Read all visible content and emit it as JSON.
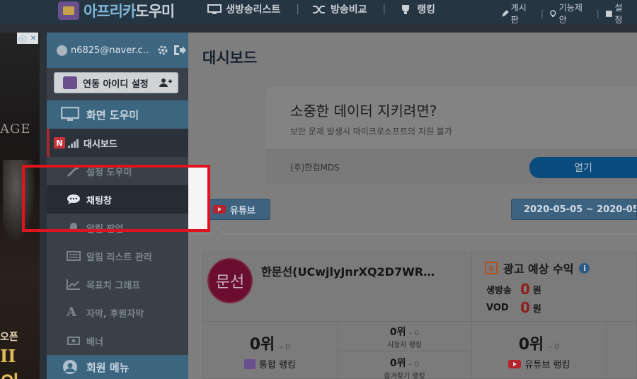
{
  "header": {
    "logo_text_a": "아프리카",
    "logo_text_b": "도우미",
    "nav": [
      {
        "label": "생방송리스트",
        "icon": "monitor-icon"
      },
      {
        "label": "방송비교",
        "icon": "shuffle-icon"
      },
      {
        "label": "랭킹",
        "icon": "trophy-icon"
      }
    ],
    "right_links": [
      {
        "label": "게시판",
        "icon": "pencil-icon"
      },
      {
        "label": "기능제안",
        "icon": "lightbulb-icon"
      },
      {
        "label": "설정",
        "icon": "book-icon"
      }
    ]
  },
  "left_ad": {
    "word": "AGE",
    "line1": "오픈",
    "line2": "II",
    "line3": "의"
  },
  "sidebar": {
    "user_email": "n6825@naver.c…",
    "link_account_label": "연동 아이디 설정",
    "group_screen": "화면 도우미",
    "group_member": "회원 메뉴",
    "items": [
      {
        "label": "대시보드",
        "badge": "N"
      },
      {
        "label": "설정 도우미"
      },
      {
        "label": "채팅창"
      },
      {
        "label": "알림 팝업"
      },
      {
        "label": "알림 리스트 관리"
      },
      {
        "label": "목표치 그래프"
      },
      {
        "label": "자막, 후원자막"
      },
      {
        "label": "배너"
      }
    ]
  },
  "main": {
    "page_title": "대시보드",
    "ad": {
      "headline": "소중한 데이터 지키려면?",
      "sub": "보안 문제 발생시 마이크로소프트의 지원 불가",
      "company": "(주)한컴MDS",
      "open_label": "열기"
    },
    "platform_button": "유튜브",
    "date_range": "2020-05-05 ~ 2020-05",
    "channel": {
      "avatar_text": "문선",
      "name": "한문선(UCwjlyJnrXQ2D7WR…"
    },
    "revenue": {
      "title": "광고 예상 수익",
      "live_label": "생방송",
      "live_value": "0",
      "vod_label": "VOD",
      "vod_value": "0",
      "unit": "원"
    },
    "ranks": {
      "total_value": "0위",
      "total_delta": "– 0",
      "total_label": "통합 랭킹",
      "viewer_value": "0위",
      "viewer_delta": "– 0",
      "viewer_label": "시청자 랭킹",
      "fav_value": "0위",
      "fav_delta": "– 0",
      "fav_label": "즐겨찾기 랭킹",
      "youtube_value": "0위",
      "youtube_delta": "– 0",
      "youtube_label": "유튜브 랭킹"
    }
  }
}
